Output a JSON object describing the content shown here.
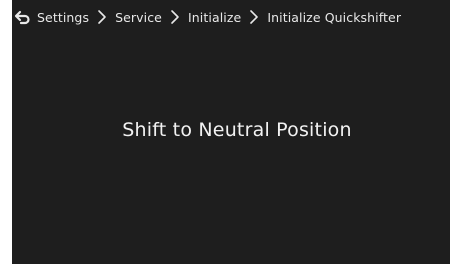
{
  "breadcrumb": {
    "items": [
      {
        "label": "Settings"
      },
      {
        "label": "Service"
      },
      {
        "label": "Initialize"
      },
      {
        "label": "Initialize Quickshifter"
      }
    ],
    "back_icon": "back-arrow-icon",
    "separator_icon": "chevron-right-icon"
  },
  "main": {
    "message": "Shift to Neutral Position"
  },
  "colors": {
    "background": "#1e1e1e",
    "text": "#e8e8e8"
  }
}
